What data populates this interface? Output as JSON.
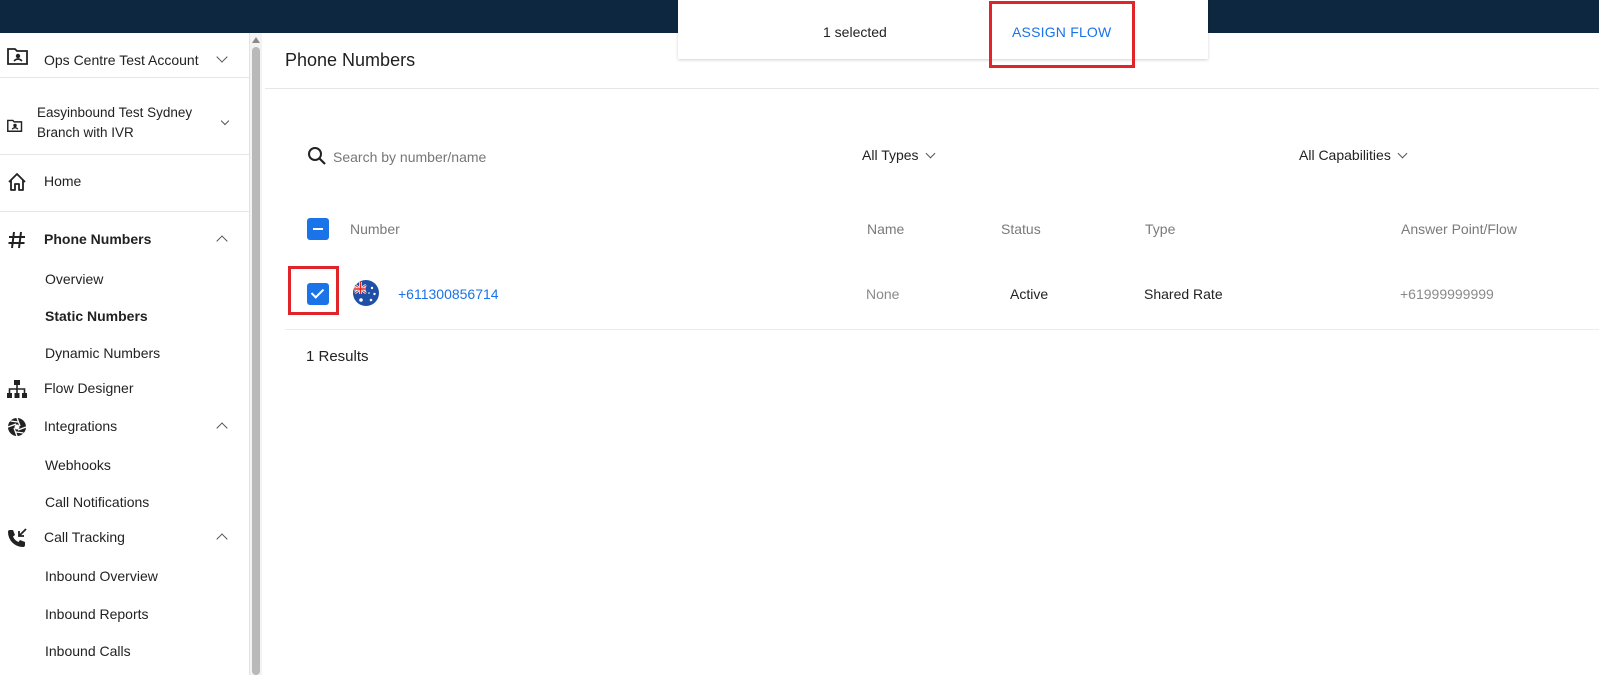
{
  "selection_bar": {
    "count_text": "1 selected",
    "assign_label": "ASSIGN FLOW"
  },
  "sidebar": {
    "accounts": [
      {
        "label": "Ops Centre Test Account",
        "icon": "account-folder-icon"
      },
      {
        "label_lines": [
          "Easyinbound Test Sydney",
          "Branch with IVR"
        ],
        "icon": "account-folder-icon"
      }
    ],
    "home": {
      "label": "Home",
      "icon": "home-icon"
    },
    "sections": [
      {
        "label": "Phone Numbers",
        "icon": "hash-icon",
        "expanded": true,
        "items": [
          "Overview",
          "Static Numbers",
          "Dynamic Numbers"
        ],
        "active_item": "Static Numbers"
      },
      {
        "label": "Flow Designer",
        "icon": "sitemap-icon"
      },
      {
        "label": "Integrations",
        "icon": "aperture-icon",
        "expanded": true,
        "items": [
          "Webhooks",
          "Call Notifications"
        ]
      },
      {
        "label": "Call Tracking",
        "icon": "incoming-call-icon",
        "expanded": true,
        "items": [
          "Inbound Overview",
          "Inbound Reports",
          "Inbound Calls"
        ]
      }
    ]
  },
  "main": {
    "title": "Phone Numbers",
    "search": {
      "placeholder": "Search by number/name",
      "value": ""
    },
    "filters": {
      "type": "All Types",
      "capabilities": "All Capabilities"
    },
    "table": {
      "headers": [
        "Number",
        "Name",
        "Status",
        "Type",
        "Answer Point/Flow"
      ],
      "rows": [
        {
          "selected": true,
          "country": "AU",
          "number": "+611300856714",
          "name": "None",
          "status": "Active",
          "type": "Shared Rate",
          "answer_point": "+61999999999"
        }
      ]
    },
    "results_text": "1 Results"
  },
  "colors": {
    "topbar": "#0d2740",
    "accent": "#1a73e8",
    "annotation": "#e0242a"
  }
}
